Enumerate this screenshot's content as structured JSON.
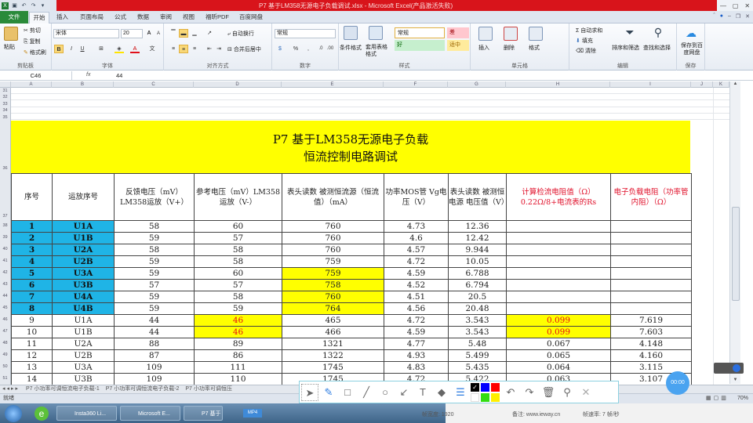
{
  "window": {
    "title": "P7 基于LM358无源电子负载调试.xlsx - Microsoft Excel(产品激活失败)",
    "controls": [
      "minimize",
      "restore",
      "close"
    ]
  },
  "quick_access": [
    "excel-logo",
    "save",
    "undo",
    "redo",
    "customize"
  ],
  "ribbon_tabs": [
    "文件",
    "开始",
    "插入",
    "页面布局",
    "公式",
    "数据",
    "审阅",
    "视图",
    "福昕PDF",
    "百度网盘"
  ],
  "active_tab": "开始",
  "ribbon": {
    "clipboard": {
      "label": "剪贴板",
      "paste": "粘贴",
      "cut": "剪切",
      "copy": "复制",
      "format_painter": "格式刷"
    },
    "font": {
      "label": "字体",
      "font_name": "宋体",
      "font_size": "20",
      "bold": "B",
      "italic": "I",
      "underline": "U",
      "grow": "A",
      "shrink": "A"
    },
    "alignment": {
      "label": "对齐方式",
      "wrap": "自动换行",
      "merge": "合并后居中"
    },
    "number": {
      "label": "数字",
      "format": "常规",
      "percent": "%",
      "comma": ","
    },
    "styles": {
      "label": "样式",
      "conditional": "条件格式",
      "table": "套用表格格式",
      "normal": "常规",
      "bad": "差",
      "good": "好",
      "neutral": "适中"
    },
    "cells": {
      "label": "单元格",
      "insert": "插入",
      "delete": "删除",
      "format": "格式"
    },
    "editing": {
      "label": "编辑",
      "autosum": "自动求和",
      "fill": "填充",
      "clear": "清除",
      "sort": "排序和筛选",
      "find": "查找和选择"
    },
    "save": {
      "label": "保存",
      "baidu": "保存到百度网盘"
    }
  },
  "formula_bar": {
    "name_box": "C46",
    "fx": "fx",
    "value": "44"
  },
  "columns": [
    "A",
    "B",
    "C",
    "D",
    "E",
    "F",
    "G",
    "H",
    "I",
    "J",
    "K"
  ],
  "empty_rows": [
    "31",
    "32",
    "33",
    "34",
    "35"
  ],
  "banner": {
    "row": "36",
    "line1": "P7  基于LM358无源电子负载",
    "line2": "恒流控制电路调试"
  },
  "table": {
    "header_row": "37",
    "headers": [
      "序号",
      "运放序号",
      "反馈电压（mV）LM358运放（V+）",
      "参考电压（mV）LM358运放（V-）",
      "表头读数 被测恒流源（恒流值）（mA）",
      "功率MOS管 Vg电压（V）",
      "表头读数 被测恒电源 电压值（V）",
      "计算检流电阻值（Ω）0.22Ω/8+电流表的Rs",
      "电子负载电阻（功率管内阻）（Ω）"
    ],
    "rows": [
      {
        "row": "38",
        "cells": [
          "1",
          "U1A",
          "58",
          "60",
          "760",
          "4.73",
          "12.36",
          "",
          ""
        ]
      },
      {
        "row": "39",
        "cells": [
          "2",
          "U1B",
          "59",
          "57",
          "760",
          "4.6",
          "12.42",
          "",
          ""
        ]
      },
      {
        "row": "40",
        "cells": [
          "3",
          "U2A",
          "58",
          "58",
          "760",
          "4.57",
          "9.944",
          "",
          ""
        ]
      },
      {
        "row": "41",
        "cells": [
          "4",
          "U2B",
          "59",
          "58",
          "759",
          "4.72",
          "10.05",
          "",
          ""
        ]
      },
      {
        "row": "42",
        "cells": [
          "5",
          "U3A",
          "59",
          "60",
          "759",
          "4.59",
          "6.788",
          "",
          ""
        ]
      },
      {
        "row": "43",
        "cells": [
          "6",
          "U3B",
          "57",
          "57",
          "758",
          "4.52",
          "6.794",
          "",
          ""
        ]
      },
      {
        "row": "44",
        "cells": [
          "7",
          "U4A",
          "59",
          "58",
          "760",
          "4.51",
          "20.5",
          "",
          ""
        ]
      },
      {
        "row": "45",
        "cells": [
          "8",
          "U4B",
          "59",
          "59",
          "764",
          "4.56",
          "20.48",
          "",
          ""
        ]
      },
      {
        "row": "46",
        "cells": [
          "9",
          "U1A",
          "44",
          "46",
          "465",
          "4.72",
          "3.543",
          "0.099",
          "7.619"
        ]
      },
      {
        "row": "47",
        "cells": [
          "10",
          "U1B",
          "44",
          "46",
          "466",
          "4.59",
          "3.543",
          "0.099",
          "7.603"
        ]
      },
      {
        "row": "48",
        "cells": [
          "11",
          "U2A",
          "88",
          "89",
          "1321",
          "4.77",
          "5.48",
          "0.067",
          "4.148"
        ]
      },
      {
        "row": "49",
        "cells": [
          "12",
          "U2B",
          "87",
          "86",
          "1322",
          "4.93",
          "5.499",
          "0.065",
          "4.160"
        ]
      },
      {
        "row": "50",
        "cells": [
          "13",
          "U3A",
          "109",
          "111",
          "1745",
          "4.83",
          "5.435",
          "0.064",
          "3.115"
        ]
      },
      {
        "row": "51",
        "cells": [
          "14",
          "U3B",
          "109",
          "110",
          "1745",
          "4.72",
          "5.422",
          "0.063",
          "3.107"
        ]
      }
    ],
    "highlight_colors": {
      "blue": "#1fb4e6",
      "yellow": "#ffff00",
      "red_text": "#e81010"
    }
  },
  "sheet_tabs": [
    "P7 小功率可调恒流电子负载-1",
    "P7 小功率可调恒流电子负载-2",
    "P7 小功率可调恒压"
  ],
  "status": {
    "ready": "就绪",
    "zoom": "70%"
  },
  "taskbar": {
    "items": [
      "Insta360 Li...",
      "Microsoft E...",
      "P7 基于"
    ],
    "mp4": "MP4"
  },
  "capture_info": {
    "width": "帧宽度: 1920",
    "note": "备注: www.ieway.cn",
    "fps": "帧速率: 7 帧/秒"
  },
  "draw_toolbar": {
    "tools": [
      "pointer",
      "pen",
      "rectangle",
      "line",
      "ellipse",
      "arrow",
      "text",
      "eraser",
      "line-width",
      "undo",
      "redo",
      "delete",
      "zoom",
      "close"
    ],
    "colors": [
      "#000000",
      "#0000ff",
      "#ff0000",
      "#ffffff",
      "#33dd11",
      "#ffee00"
    ]
  },
  "timer": "00:00"
}
